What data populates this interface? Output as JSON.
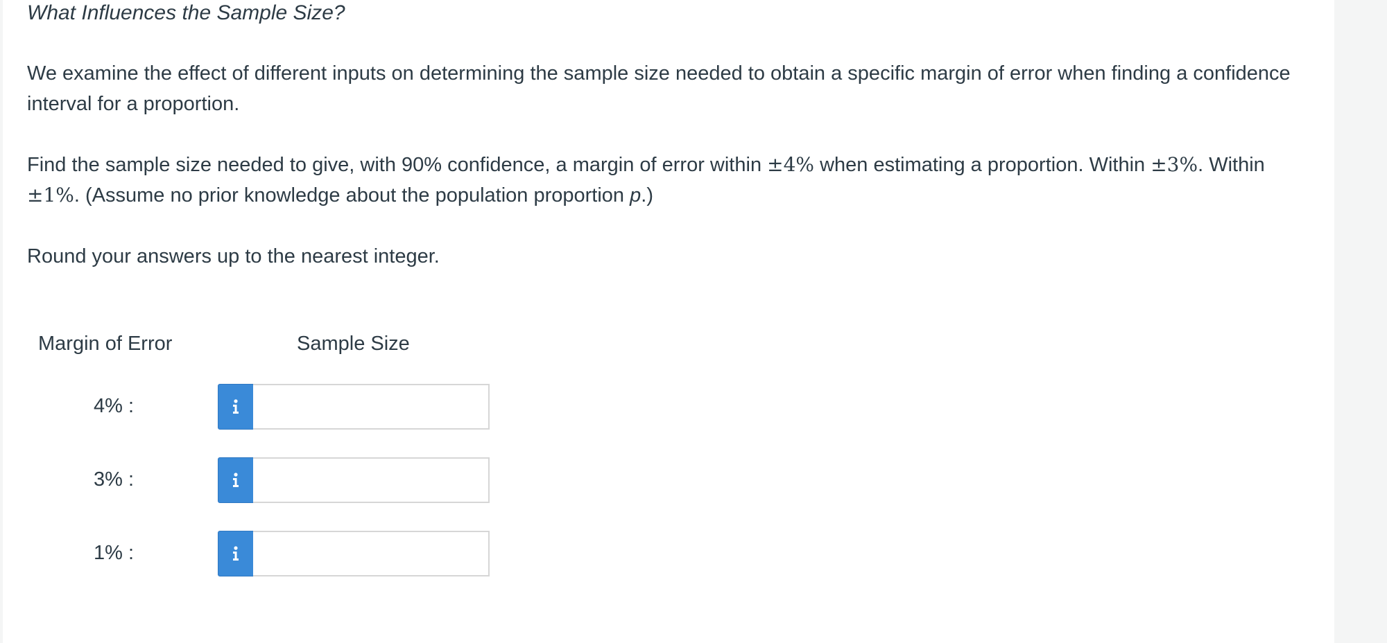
{
  "question": {
    "title": "What Influences the Sample Size?",
    "paragraph1": "We examine the effect of different inputs on determining the sample size needed to obtain a specific margin of error when finding a confidence interval for a proportion.",
    "paragraph2": {
      "t1": "Find the sample size needed to give, with 90% confidence, a margin of error within ",
      "m1": "±4%",
      "t2": " when estimating a proportion. Within ",
      "m2": "±3%",
      "t3": ". Within ",
      "m3": "±1%",
      "t4": ". (Assume no prior knowledge about the population proportion ",
      "var": "p",
      "t5": ".)"
    },
    "paragraph3": "Round your answers up to the nearest integer."
  },
  "table": {
    "header_margin": "Margin of Error",
    "header_size": "Sample Size",
    "rows": [
      {
        "label": "4% :",
        "value": "",
        "info_icon": "info-icon"
      },
      {
        "label": "3% :",
        "value": "",
        "info_icon": "info-icon"
      },
      {
        "label": "1% :",
        "value": "",
        "info_icon": "info-icon"
      }
    ]
  },
  "colors": {
    "info_button": "#3a8ad8",
    "text": "#2d3b45",
    "input_border": "#d6d6d6"
  }
}
